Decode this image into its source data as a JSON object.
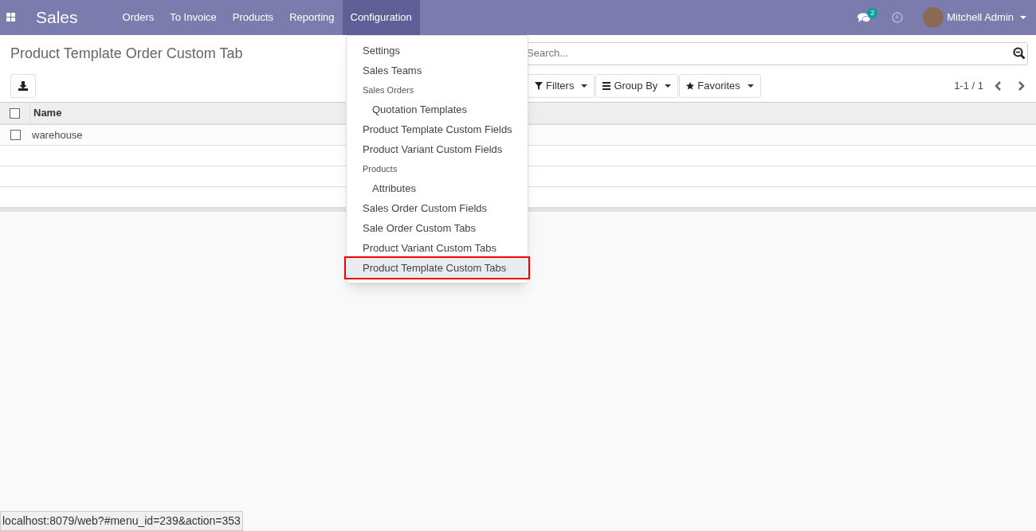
{
  "navbar": {
    "app_title": "Sales",
    "menus": [
      {
        "label": "Orders",
        "selected": false
      },
      {
        "label": "To Invoice",
        "selected": false
      },
      {
        "label": "Products",
        "selected": false
      },
      {
        "label": "Reporting",
        "selected": false
      },
      {
        "label": "Configuration",
        "selected": true
      }
    ],
    "messages_badge": "2",
    "user": "Mitchell Admin"
  },
  "dropdown": [
    {
      "kind": "item",
      "label": "Settings",
      "selected": false
    },
    {
      "kind": "item",
      "label": "Sales Teams",
      "selected": false
    },
    {
      "kind": "header",
      "label": "Sales Orders",
      "selected": false
    },
    {
      "kind": "subitem",
      "label": "Quotation Templates",
      "selected": false
    },
    {
      "kind": "item",
      "label": "Product Template Custom Fields",
      "selected": false
    },
    {
      "kind": "item",
      "label": "Product Variant Custom Fields",
      "selected": false
    },
    {
      "kind": "header",
      "label": "Products",
      "selected": false
    },
    {
      "kind": "subitem",
      "label": "Attributes",
      "selected": false
    },
    {
      "kind": "item",
      "label": "Sales Order Custom Fields",
      "selected": false
    },
    {
      "kind": "item",
      "label": "Sale Order Custom Tabs",
      "selected": false
    },
    {
      "kind": "item",
      "label": "Product Variant Custom Tabs",
      "selected": false
    },
    {
      "kind": "item",
      "label": "Product Template Custom Tabs",
      "selected": true
    }
  ],
  "control_panel": {
    "title": "Product Template Order Custom Tab",
    "search": {
      "placeholder": "Search..."
    },
    "filters": [
      "Filters",
      "Group By",
      "Favorites"
    ],
    "pager": "1-1 / 1"
  },
  "table": {
    "all_checked": false,
    "columns": [
      "Name"
    ],
    "rows": [
      {
        "name": "warehouse",
        "checked": false
      }
    ]
  },
  "status_url": "localhost:8079/web?#menu_id=239&action=353"
}
